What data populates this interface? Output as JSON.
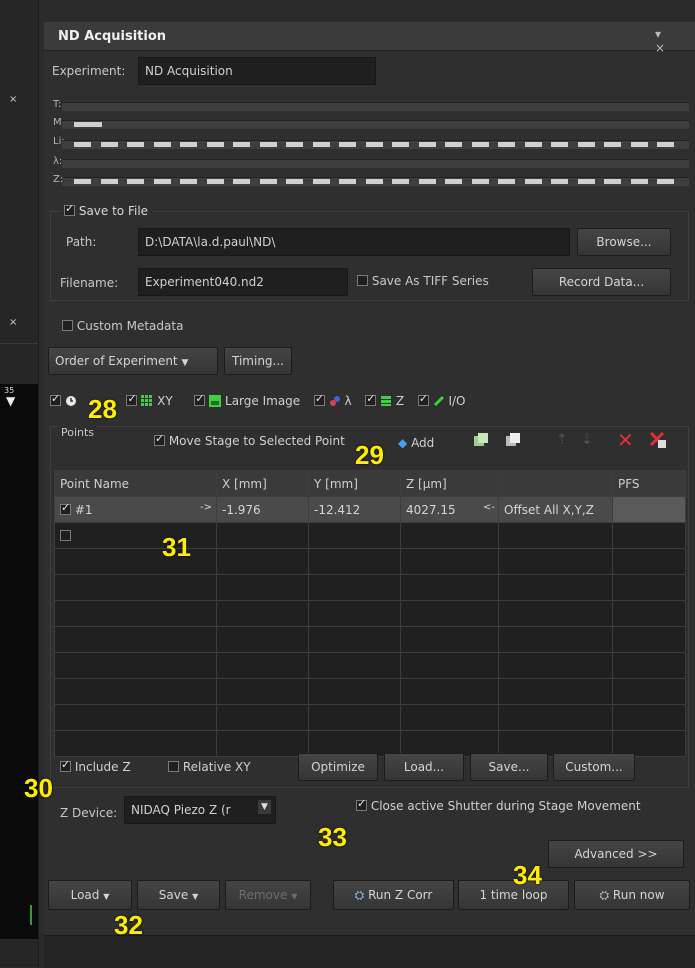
{
  "window": {
    "title": "ND Acquisition",
    "controls": "▾ ×"
  },
  "left_strip": {
    "marks": [
      "×",
      "×"
    ],
    "number": "35",
    "arrow": "▼"
  },
  "experiment": {
    "label": "Experiment:",
    "value": "ND Acquisition"
  },
  "timeline": {
    "rows": [
      "T:",
      "M:",
      "Li:",
      "λ:",
      "Z:"
    ]
  },
  "save": {
    "group_label": "Save to File",
    "checked": true,
    "path_label": "Path:",
    "path_value": "D:\\DATA\\la.d.paul\\ND\\",
    "browse": "Browse...",
    "filename_label": "Filename:",
    "filename_value": "Experiment040.nd2",
    "tiff_label": "Save As TIFF Series",
    "record": "Record Data..."
  },
  "custom_metadata": "Custom Metadata",
  "order_button": "Order of Experiment",
  "timing_button": "Timing...",
  "tabs": [
    {
      "label": "",
      "icon": "clock-icon"
    },
    {
      "label": "XY",
      "icon": "grid-icon"
    },
    {
      "label": "Large Image",
      "icon": "large-image-icon"
    },
    {
      "label": "λ",
      "icon": "lambda-icon"
    },
    {
      "label": "Z",
      "icon": "z-stack-icon"
    },
    {
      "label": "I/O",
      "icon": "io-icon"
    }
  ],
  "points": {
    "group_label": "Points",
    "move_stage": "Move Stage to Selected Point",
    "add": "Add",
    "columns": [
      "Point Name",
      "X [mm]",
      "Y [mm]",
      "Z [µm]",
      "",
      "PFS"
    ],
    "rows": [
      {
        "checked": true,
        "name": "#1",
        "arrow": "->",
        "x": "-1.976",
        "y": "-12.412",
        "z": "4027.15",
        "back": "<-",
        "offset": "Offset All X,Y,Z",
        "pfs": ""
      }
    ]
  },
  "bottom_options": {
    "include_z": "Include Z",
    "relative_xy": "Relative XY",
    "optimize": "Optimize",
    "load": "Load...",
    "save": "Save...",
    "custom": "Custom...",
    "z_device_label": "Z Device:",
    "z_device_value": "NIDAQ Piezo Z (r",
    "close_shutter": "Close active Shutter during Stage Movement",
    "advanced": "Advanced >>"
  },
  "footer": {
    "load": "Load",
    "save": "Save",
    "remove": "Remove",
    "run_z_corr": "Run Z Corr",
    "one_time_loop": "1 time loop",
    "run_now": "Run now"
  },
  "callouts": [
    "28",
    "29",
    "30",
    "31",
    "32",
    "33",
    "34"
  ],
  "colors": {
    "background": "#2f2f2f",
    "callout": "#ffee00",
    "field": "#1f1f1f",
    "remove_disabled": "#6e6e6e"
  }
}
